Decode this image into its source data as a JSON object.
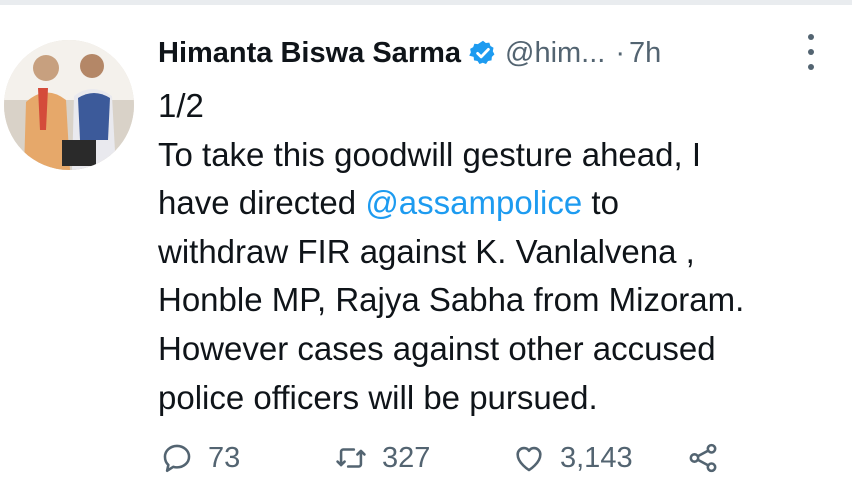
{
  "tweet": {
    "author_name": "Himanta Biswa Sarma",
    "handle": "@him...",
    "separator": "·",
    "time": "7h",
    "text_line_1": "1/2",
    "text_line_2": "To take this goodwill gesture ahead, I",
    "text_line_3_prefix": "have directed ",
    "mention": "@assampolice",
    "text_line_3_suffix": " to",
    "text_line_4": "withdraw FIR against  K. Vanlalvena ,",
    "text_line_5": "Honble MP, Rajya Sabha from Mizoram.",
    "text_line_6": "However cases against other accused",
    "text_line_7": "police officers will be pursued."
  },
  "actions": {
    "replies": "73",
    "retweets": "327",
    "likes": "3,143"
  },
  "icons": {
    "verified": "verified-badge-icon",
    "more": "more-vertical-icon",
    "reply": "reply-icon",
    "retweet": "retweet-icon",
    "like": "heart-icon",
    "share": "share-icon"
  },
  "colors": {
    "mention": "#1d9bf0",
    "verified": "#1d9bf0",
    "secondary_text": "#536471",
    "primary_text": "#0f1419"
  }
}
